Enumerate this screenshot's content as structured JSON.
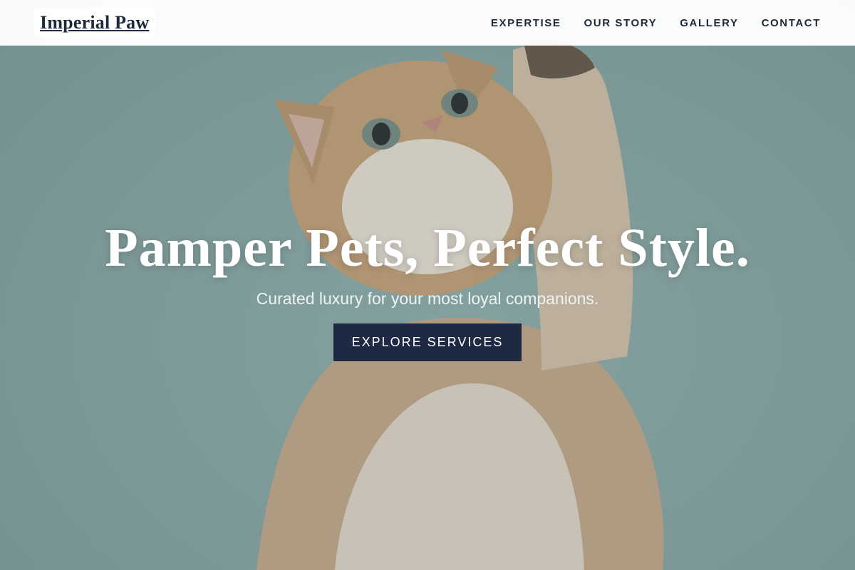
{
  "header": {
    "logo": "Imperial Paw",
    "nav": [
      {
        "label": "EXPERTISE"
      },
      {
        "label": "OUR STORY"
      },
      {
        "label": "GALLERY"
      },
      {
        "label": "CONTACT"
      }
    ]
  },
  "hero": {
    "title": "Pamper Pets, Perfect Style.",
    "subtitle": "Curated luxury for your most loyal companions.",
    "cta_label": "EXPLORE SERVICES",
    "image": "cat-reaching-up-photo"
  },
  "colors": {
    "brand_navy": "#1e2a44",
    "header_bg": "#ffffff",
    "hero_bg": "#8fb0ad"
  }
}
